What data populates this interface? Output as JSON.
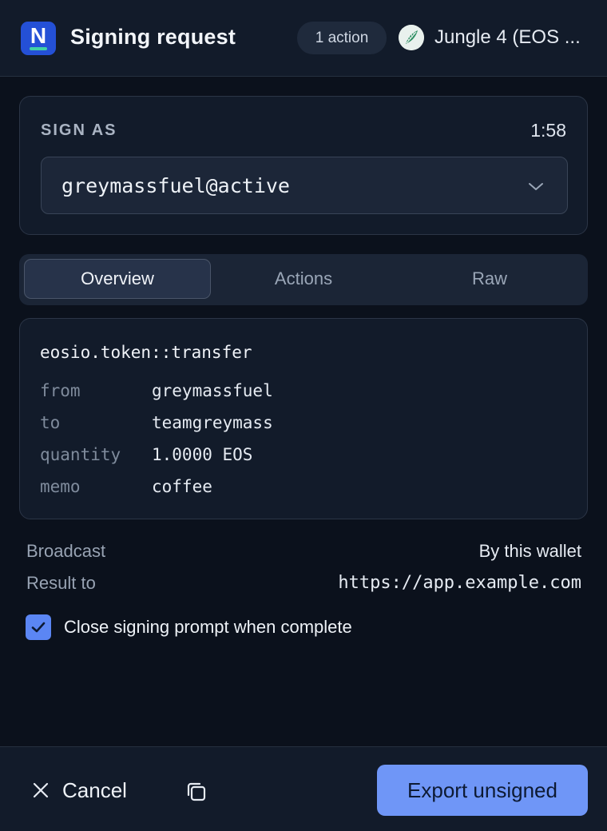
{
  "header": {
    "title": "Signing request",
    "action_count": "1 action",
    "chain": "Jungle 4 (EOS ...",
    "logo_letter": "N"
  },
  "sign_as": {
    "label": "SIGN AS",
    "timer": "1:58",
    "account": "greymassfuel@active"
  },
  "tabs": [
    {
      "label": "Overview",
      "active": true
    },
    {
      "label": "Actions",
      "active": false
    },
    {
      "label": "Raw",
      "active": false
    }
  ],
  "action": {
    "name": "eosio.token::transfer",
    "fields": [
      {
        "key": "from",
        "value": "greymassfuel"
      },
      {
        "key": "to",
        "value": "teamgreymass"
      },
      {
        "key": "quantity",
        "value": "1.0000 EOS"
      },
      {
        "key": "memo",
        "value": "coffee"
      }
    ]
  },
  "meta": {
    "broadcast_label": "Broadcast",
    "broadcast_value": "By this wallet",
    "result_label": "Result to",
    "result_value": "https://app.example.com"
  },
  "close_prompt": {
    "label": "Close signing prompt when complete",
    "checked": true
  },
  "footer": {
    "cancel_label": "Cancel",
    "export_label": "Export unsigned"
  },
  "colors": {
    "background": "#0b111c",
    "panel": "#121b2a",
    "accent": "#6f96f7",
    "logo": "#2450d6"
  }
}
